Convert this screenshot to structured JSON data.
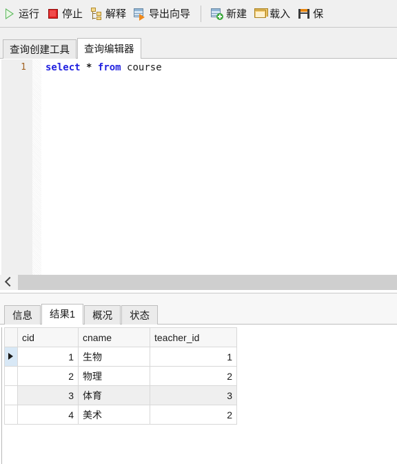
{
  "toolbar": {
    "buttons": [
      {
        "label": "运行",
        "icon": "play-run-icon"
      },
      {
        "label": "停止",
        "icon": "stop-square-icon"
      },
      {
        "label": "解释",
        "icon": "explain-tree-icon"
      },
      {
        "label": "导出向导",
        "icon": "export-wizard-icon"
      },
      {
        "label": "新建",
        "icon": "new-query-icon"
      },
      {
        "label": "载入",
        "icon": "folder-open-icon"
      },
      {
        "label": "保",
        "icon": "save-floppy-icon"
      }
    ]
  },
  "editor_tabs": {
    "items": [
      {
        "label": "查询创建工具",
        "active": false
      },
      {
        "label": "查询编辑器",
        "active": true
      }
    ]
  },
  "editor": {
    "line_number": "1",
    "tokens": {
      "select": "select",
      "space1": " ",
      "star": "*",
      "space2": " ",
      "from": "from",
      "space3": " ",
      "table": "course"
    },
    "full_text": "select * from course"
  },
  "scrollbar": {
    "left_arrow": "scroll-left-chevron"
  },
  "result_tabs": {
    "items": [
      {
        "label": "信息",
        "active": false
      },
      {
        "label": "结果1",
        "active": true
      },
      {
        "label": "概况",
        "active": false
      },
      {
        "label": "状态",
        "active": false
      }
    ]
  },
  "result_grid": {
    "columns": [
      "cid",
      "cname",
      "teacher_id"
    ],
    "selected_column": "cid",
    "current_row_index": 0,
    "rows": [
      {
        "cid": "1",
        "cname": "生物",
        "teacher_id": "1"
      },
      {
        "cid": "2",
        "cname": "物理",
        "teacher_id": "2"
      },
      {
        "cid": "3",
        "cname": "体育",
        "teacher_id": "3"
      },
      {
        "cid": "4",
        "cname": "美术",
        "teacher_id": "2"
      }
    ]
  },
  "colors": {
    "keyword_blue": "#2222e0",
    "linenum_orange": "#a06020",
    "selected_header": "#cfe3f5",
    "alt_row": "#efefef",
    "toolbar_bg": "#f0f0f0"
  }
}
